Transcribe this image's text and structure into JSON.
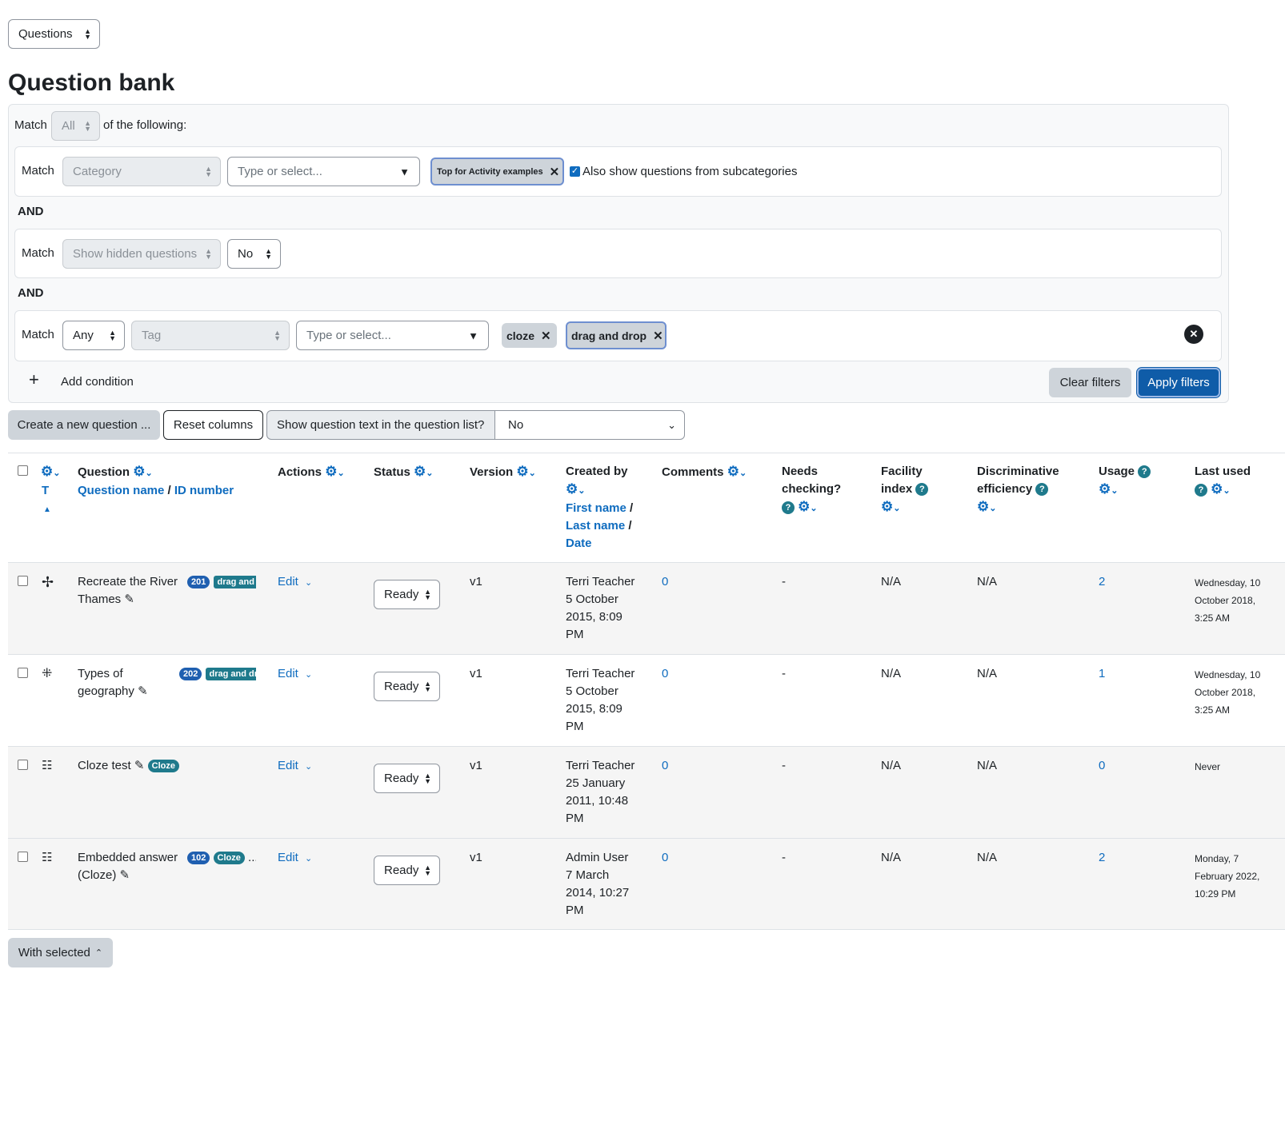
{
  "top_select": {
    "value": "Questions"
  },
  "page_title": "Question bank",
  "filter": {
    "match_label": "Match",
    "match_all_value": "All",
    "of_following": "of the following:",
    "and_label": "AND",
    "row1": {
      "match": "Match",
      "type_value": "Category",
      "type_placeholder": "Type or select...",
      "chip": "Top for Activity examples",
      "subcat_label": "Also show questions from subcategories"
    },
    "row2": {
      "match": "Match",
      "type_value": "Show hidden questions",
      "value": "No"
    },
    "row3": {
      "match": "Match",
      "any_value": "Any",
      "type_value": "Tag",
      "type_placeholder": "Type or select...",
      "chips": [
        "cloze",
        "drag and drop"
      ]
    },
    "add_condition": "Add condition",
    "clear_filters": "Clear filters",
    "apply_filters": "Apply filters"
  },
  "toolbar": {
    "create_question": "Create a new question ...",
    "reset_columns": "Reset columns",
    "show_text_label": "Show question text in the question list?",
    "show_text_value": "No"
  },
  "table": {
    "headers": {
      "type_short": "T",
      "question": "Question",
      "question_name": "Question name",
      "id_number": "ID number",
      "slash": "/",
      "actions": "Actions",
      "status": "Status",
      "version": "Version",
      "created_by": "Created by",
      "first_name": "First name",
      "last_name": "Last name",
      "date": "Date",
      "comments": "Comments",
      "needs_line1": "Needs",
      "needs_line2": "checking?",
      "facility_line1": "Facility",
      "facility_line2": "index",
      "disc_line1": "Discriminative",
      "disc_line2": "efficiency",
      "usage": "Usage",
      "last_used": "Last used"
    },
    "rows": [
      {
        "name_line1": "Recreate the River",
        "name_line2": "Thames",
        "id_badge": "201",
        "tag_badge": "drag and",
        "action": "Edit",
        "status": "Ready",
        "version": "v1",
        "creator": "Terri Teacher",
        "created_line1": "5 October",
        "created_line2": "2015, 8:09",
        "created_line3": "PM",
        "comments": "0",
        "needs_checking": "-",
        "facility": "N/A",
        "discriminative": "N/A",
        "usage": "2",
        "last_used_line1": "Wednesday, 10",
        "last_used_line2": "October 2018,",
        "last_used_line3": "3:25 AM"
      },
      {
        "name_line1": "Types of",
        "name_line2": "geography",
        "id_badge": "202",
        "tag_badge": "drag and dr",
        "action": "Edit",
        "status": "Ready",
        "version": "v1",
        "creator": "Terri Teacher",
        "created_line1": "5 October",
        "created_line2": "2015, 8:09",
        "created_line3": "PM",
        "comments": "0",
        "needs_checking": "-",
        "facility": "N/A",
        "discriminative": "N/A",
        "usage": "1",
        "last_used_line1": "Wednesday, 10",
        "last_used_line2": "October 2018,",
        "last_used_line3": "3:25 AM"
      },
      {
        "name_line1": "Cloze test",
        "tag_badge": "Cloze",
        "action": "Edit",
        "status": "Ready",
        "version": "v1",
        "creator": "Terri Teacher",
        "created_line1": "25 January",
        "created_line2": "2011, 10:48",
        "created_line3": "PM",
        "comments": "0",
        "needs_checking": "-",
        "facility": "N/A",
        "discriminative": "N/A",
        "usage": "0",
        "last_used_line1": "Never"
      },
      {
        "name_line1": "Embedded answer",
        "name_line2": "(Cloze)",
        "id_badge": "102",
        "tag_badge": "Cloze",
        "ellipsis": "...",
        "action": "Edit",
        "status": "Ready",
        "version": "v1",
        "creator": "Admin User",
        "created_line1": "7 March",
        "created_line2": "2014, 10:27",
        "created_line3": "PM",
        "comments": "0",
        "needs_checking": "-",
        "facility": "N/A",
        "discriminative": "N/A",
        "usage": "2",
        "last_used_line1": "Monday, 7",
        "last_used_line2": "February 2022,",
        "last_used_line3": "10:29 PM"
      }
    ]
  },
  "with_selected": "With selected"
}
